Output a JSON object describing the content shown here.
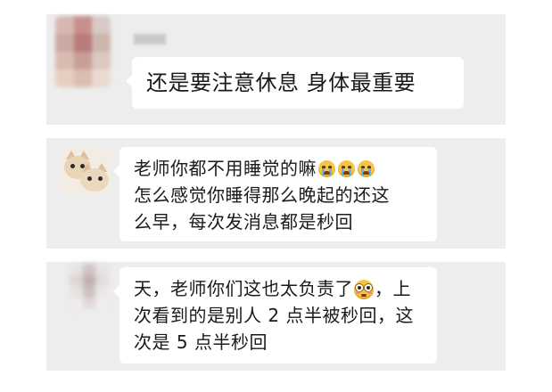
{
  "messages": [
    {
      "id": "m1",
      "avatar": "blurred-avatar",
      "sender_name_hidden": true,
      "lines": [
        "还是要注意休息 身体最重要"
      ]
    },
    {
      "id": "m2",
      "avatar": "cats-avatar",
      "line1_text": "老师你都不用睡觉的嘛",
      "line1_emojis": [
        "crying-face-emoji",
        "crying-face-emoji",
        "crying-face-emoji"
      ],
      "line2": "怎么感觉你睡得那么晚起的还这",
      "line3": "么早，每次发消息都是秒回"
    },
    {
      "id": "m3",
      "avatar": "blurred-avatar",
      "line1_before": "天，老师你们这也太负责了",
      "line1_emoji": "flushed-face-emoji",
      "line1_after": "，上",
      "line2": "次看到的是别人 2 点半被秒回，这",
      "line3": "次是 5 点半秒回"
    }
  ],
  "colors": {
    "panel_bg": "#ededed",
    "bubble_bg": "#ffffff",
    "text": "#1a1a1a"
  }
}
